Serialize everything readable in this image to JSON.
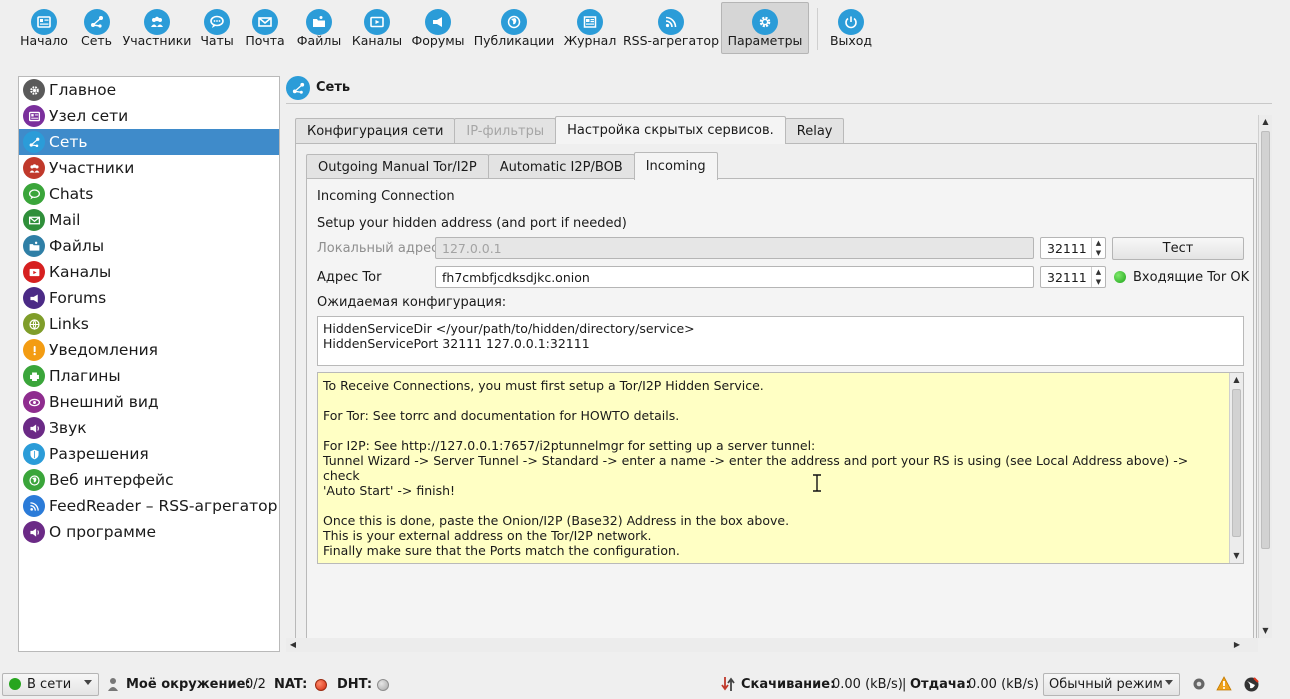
{
  "toolbar": {
    "items": [
      {
        "label": "Начало",
        "icon": "home-card-icon"
      },
      {
        "label": "Сеть",
        "icon": "network-icon"
      },
      {
        "label": "Участники",
        "icon": "people-icon"
      },
      {
        "label": "Чаты",
        "icon": "chat-bubble-icon"
      },
      {
        "label": "Почта",
        "icon": "mail-icon"
      },
      {
        "label": "Файлы",
        "icon": "files-icon"
      },
      {
        "label": "Каналы",
        "icon": "channel-icon"
      },
      {
        "label": "Форумы",
        "icon": "forum-icon"
      },
      {
        "label": "Публикации",
        "icon": "globe-icon"
      },
      {
        "label": "Журнал",
        "icon": "journal-icon"
      },
      {
        "label": "RSS-агрегатор",
        "icon": "rss-icon"
      },
      {
        "label": "Параметры",
        "icon": "gear-icon",
        "active": true
      },
      {
        "label": "Выход",
        "icon": "power-icon"
      }
    ]
  },
  "sidebar": {
    "items": [
      {
        "label": "Главное",
        "color": "#5a5a5a"
      },
      {
        "label": "Узел сети",
        "color": "#7a2f9c"
      },
      {
        "label": "Сеть",
        "color": "#2b9cd8",
        "active": true
      },
      {
        "label": "Участники",
        "color": "#c0392b"
      },
      {
        "label": "Chats",
        "color": "#3aa53a"
      },
      {
        "label": "Mail",
        "color": "#2f8f3a"
      },
      {
        "label": "Файлы",
        "color": "#2f7fa6"
      },
      {
        "label": "Каналы",
        "color": "#d62020"
      },
      {
        "label": "Forums",
        "color": "#4b2a86"
      },
      {
        "label": "Links",
        "color": "#7f9d2a"
      },
      {
        "label": "Уведомления",
        "color": "#f39c12"
      },
      {
        "label": "Плагины",
        "color": "#3aa53a"
      },
      {
        "label": "Внешний вид",
        "color": "#8e2c8e"
      },
      {
        "label": "Звук",
        "color": "#6b2a86"
      },
      {
        "label": "Разрешения",
        "color": "#2b9cd8"
      },
      {
        "label": "Веб интерфейс",
        "color": "#3aa53a"
      },
      {
        "label": "FeedReader – RSS-агрегатор",
        "color": "#2b7bd8"
      },
      {
        "label": "О программе",
        "color": "#6b2a86"
      }
    ]
  },
  "header": {
    "title": "Сеть"
  },
  "outer_tabs": [
    {
      "label": "Конфигурация сети",
      "state": "normal"
    },
    {
      "label": "IP-фильтры",
      "state": "disabled"
    },
    {
      "label": "Настройка скрытых сервисов.",
      "state": "active"
    },
    {
      "label": "Relay",
      "state": "normal"
    }
  ],
  "inner_tabs": [
    {
      "label": "Outgoing Manual Tor/I2P",
      "state": "normal"
    },
    {
      "label": "Automatic I2P/BOB",
      "state": "normal"
    },
    {
      "label": "Incoming",
      "state": "active"
    }
  ],
  "incoming": {
    "section_title": "Incoming Connection",
    "setup_text": "Setup your hidden address (and port if needed)",
    "local_label": "Локальный адрес",
    "local_value": "127.0.0.1",
    "local_port": "32111",
    "test_button": "Тест",
    "tor_label": "Адрес Tor",
    "tor_value": "fh7cmbfjcdksdjkc.onion",
    "tor_port": "32111",
    "tor_status": "Входящие Tor OK",
    "expected_label": "Ожидаемая конфигурация:",
    "config_lines": [
      "HiddenServiceDir </your/path/to/hidden/directory/service>",
      "HiddenServicePort 32111 127.0.0.1:32111"
    ],
    "info_text": "To Receive Connections, you must first setup a Tor/I2P Hidden Service.\n\nFor Tor: See torrc and documentation for HOWTO details.\n\nFor I2P: See http://127.0.0.1:7657/i2ptunnelmgr for setting up a server tunnel:\nTunnel Wizard -> Server Tunnel -> Standard -> enter a name -> enter the address and port your RS is using (see Local Address above) -> check\n'Auto Start' -> finish!\n\nOnce this is done, paste the Onion/I2P (Base32) Address in the box above.\nThis is your external address on the Tor/I2P network.\nFinally make sure that the Ports match the configuration.\n\nIf you have issues connecting over Tor check the Tor logs too."
  },
  "statusbar": {
    "status_combo": "В сети",
    "friends_label": "Моё окружение:",
    "friends_value": "0/2",
    "nat_label": "NAT:",
    "dht_label": "DHT:",
    "down_label": "Скачивание:",
    "down_value": "0.00 (kB/s)",
    "separator": "|",
    "up_label": "Отдача:",
    "up_value": "0.00 (kB/s)",
    "mode_combo": "Обычный режим",
    "colors": {
      "nat": "#e0361d",
      "dht": "#b8b8b8",
      "online": "#27a51f"
    }
  }
}
